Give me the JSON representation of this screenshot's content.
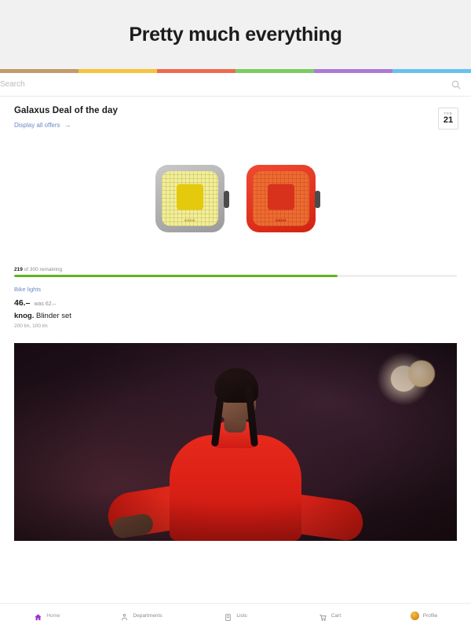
{
  "header": {
    "title": "Pretty much everything"
  },
  "color_stripe": {
    "colors": [
      "#c39a6b",
      "#f6c33f",
      "#ee6a52",
      "#7dcb63",
      "#ab7ad6",
      "#68c2f0"
    ]
  },
  "search": {
    "placeholder": "Search",
    "value": "",
    "icon": "search-icon"
  },
  "deal": {
    "heading": "Galaxus Deal of the day",
    "link_label": "Display all offers",
    "link_arrow": "→",
    "date_month": "FEB",
    "date_day": "21",
    "product": {
      "front_light_brand": "KNOG",
      "rear_light_brand": "KNOG"
    },
    "remaining_count": "219",
    "remaining_text": "of 300 remaining",
    "progress_percent": 73,
    "progress_color": "#62b320",
    "category": "Bike lights",
    "price_now": "46.–",
    "price_was": "was 62.–",
    "brand": "knog.",
    "product_name": "Blinder set",
    "spec": "200 lm, 100 lm"
  },
  "hero": {
    "alt": "performer in red outfit on stage"
  },
  "bottom_nav": {
    "items": [
      {
        "label": "Home",
        "icon": "home-icon",
        "active": true
      },
      {
        "label": "Departments",
        "icon": "departments-icon",
        "active": false
      },
      {
        "label": "Lists",
        "icon": "lists-icon",
        "active": false
      },
      {
        "label": "Cart",
        "icon": "cart-icon",
        "active": false
      },
      {
        "label": "Profile",
        "icon": "profile-avatar-icon",
        "active": false
      }
    ],
    "active_color": "#a033c8"
  }
}
